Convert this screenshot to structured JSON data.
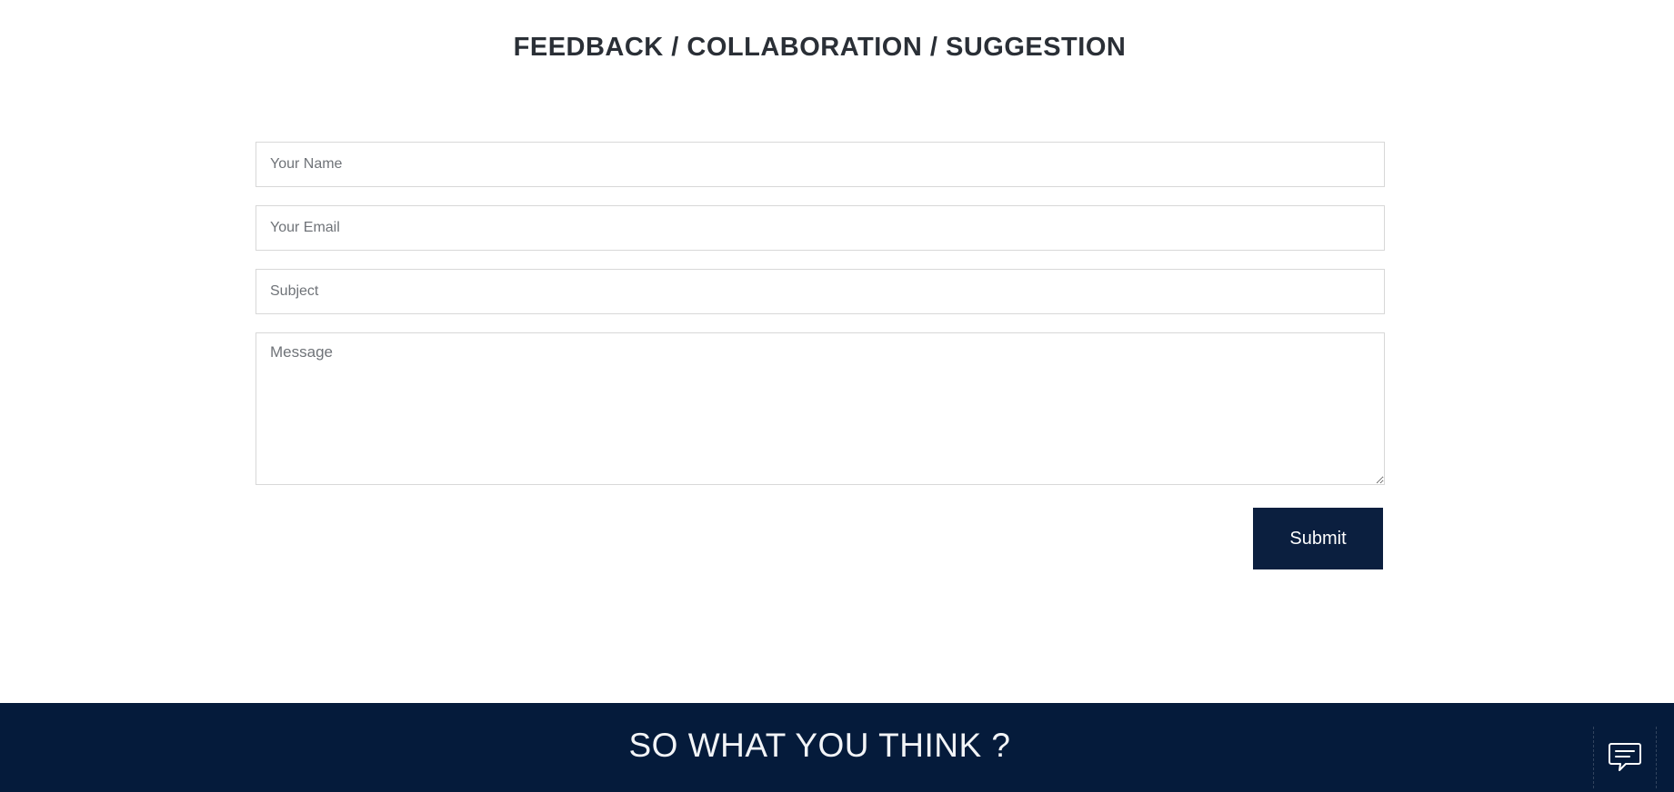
{
  "section": {
    "title": "FEEDBACK / COLLABORATION / SUGGESTION"
  },
  "form": {
    "name_placeholder": "Your Name",
    "email_placeholder": "Your Email",
    "subject_placeholder": "Subject",
    "message_placeholder": "Message",
    "submit_label": "Submit"
  },
  "footer": {
    "title": "SO WHAT YOU THINK ?"
  },
  "chat": {
    "icon": "chat-bubble-icon"
  },
  "colors": {
    "accent": "#0b1f3f",
    "footer_bg": "#051b3b",
    "heading": "#2a2f36",
    "border": "#d8d8d8"
  }
}
